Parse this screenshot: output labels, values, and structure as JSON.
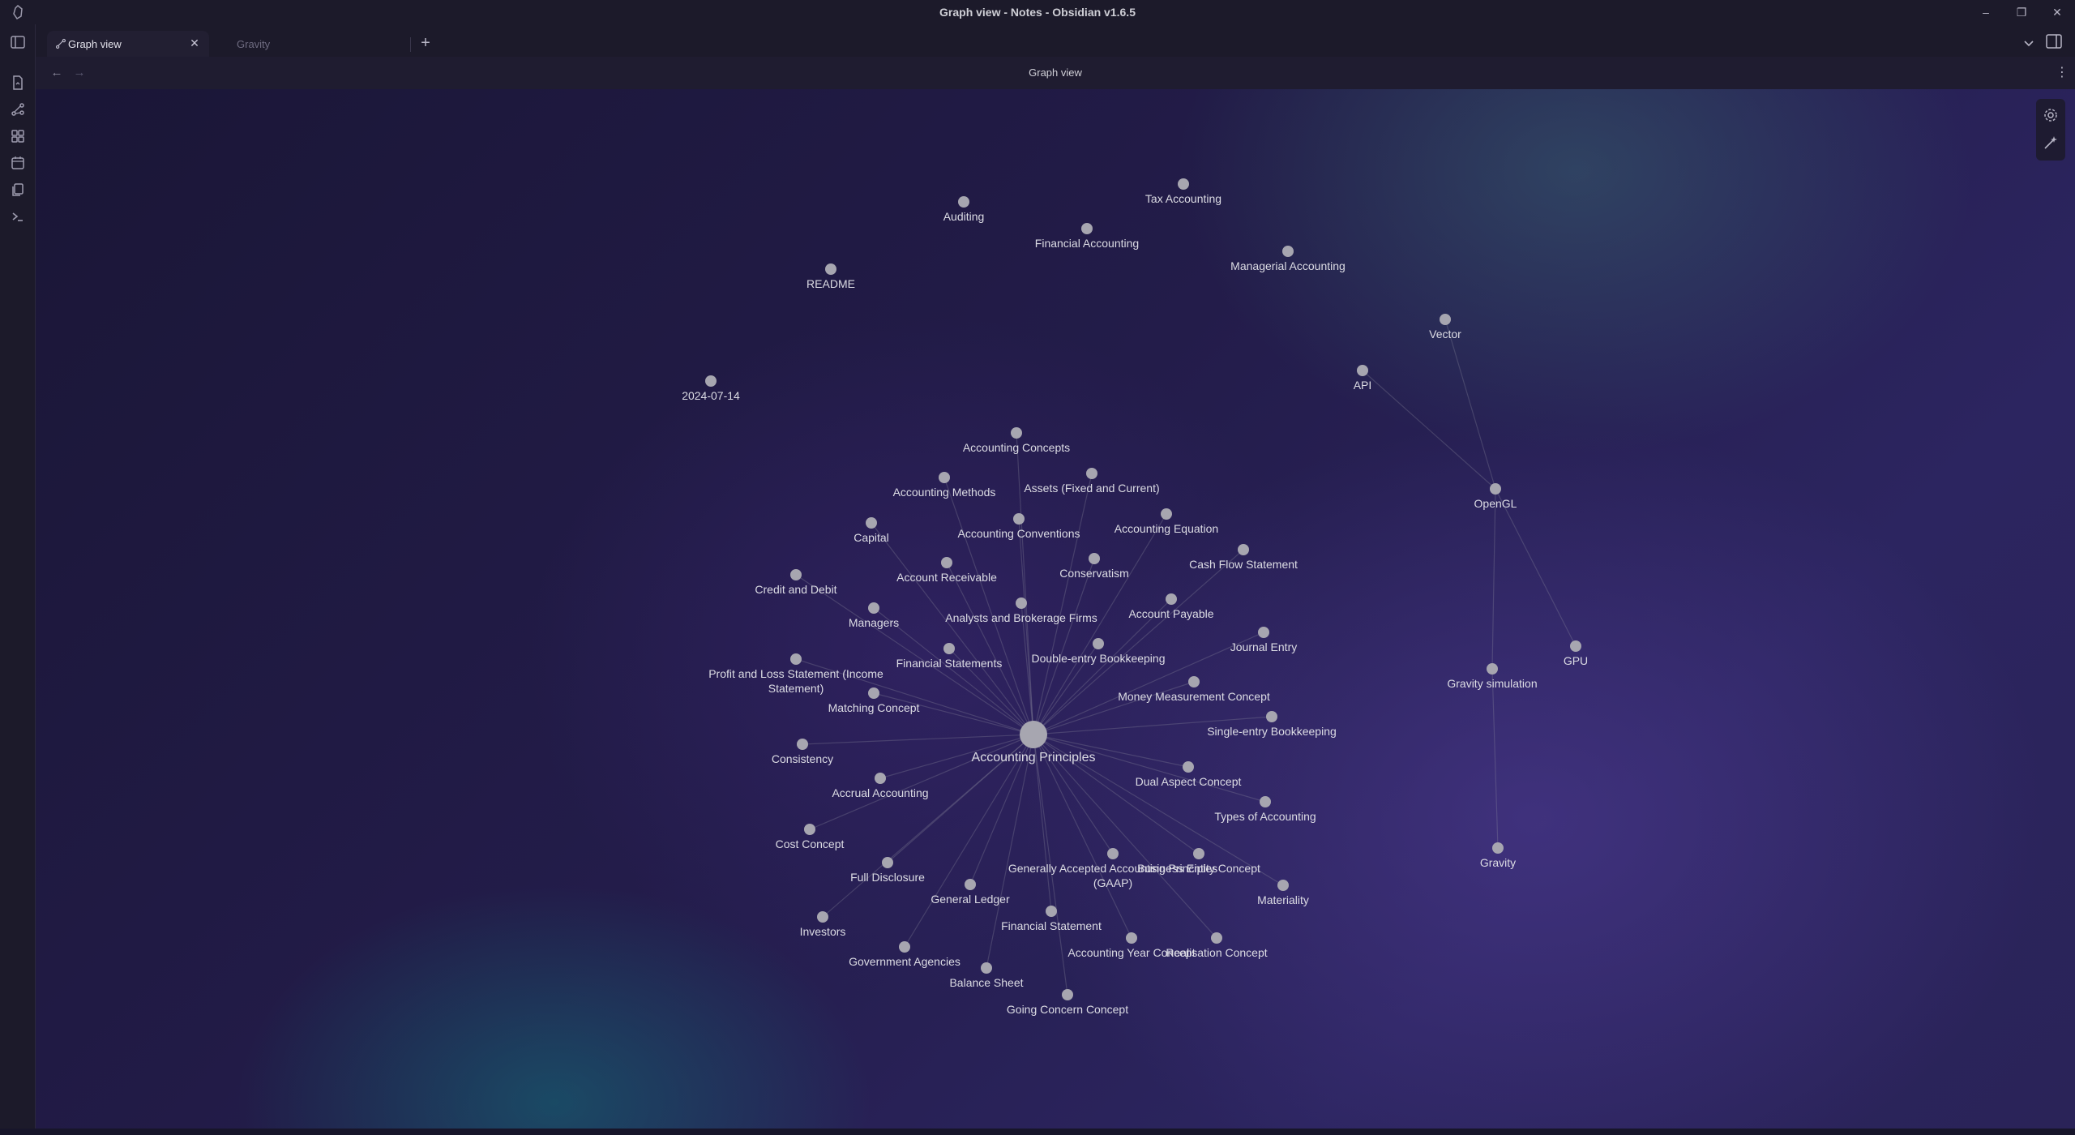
{
  "window": {
    "title": "Graph view - Notes - Obsidian v1.6.5"
  },
  "tabs": [
    {
      "label": "Graph view",
      "active": true
    },
    {
      "label": "Gravity",
      "active": false
    }
  ],
  "view_header": {
    "title": "Graph view"
  },
  "ribbon": [
    {
      "icon": "file-icon"
    },
    {
      "icon": "graph-icon"
    },
    {
      "icon": "canvas-icon"
    },
    {
      "icon": "calendar-icon"
    },
    {
      "icon": "copy-icon"
    },
    {
      "icon": "terminal-icon"
    }
  ],
  "graph": {
    "center": "Accounting Principles",
    "nodes": [
      "Auditing",
      "Tax Accounting",
      "Financial Accounting",
      "Managerial Accounting",
      "README",
      "Vector",
      "API",
      "2024-07-14",
      "OpenGL",
      "GPU",
      "Gravity simulation",
      "Gravity",
      "Accounting Concepts",
      "Assets (Fixed and Current)",
      "Accounting Methods",
      "Accounting Conventions",
      "Capital",
      "Accounting Equation",
      "Cash Flow Statement",
      "Conservatism",
      "Account Receivable",
      "Credit and Debit",
      "Managers",
      "Analysts and Brokerage Firms",
      "Account Payable",
      "Journal Entry",
      "Financial Statements",
      "Double-entry Bookkeeping",
      "Profit and Loss Statement (Income Statement)",
      "Money Measurement Concept",
      "Matching Concept",
      "Single-entry Bookkeeping",
      "Consistency",
      "Dual Aspect Concept",
      "Accrual Accounting",
      "Types of Accounting",
      "Cost Concept",
      "Generally Accepted Accounting Principles (GAAP)",
      "Business Entity Concept",
      "Full Disclosure",
      "General Ledger",
      "Materiality",
      "Investors",
      "Financial Statement",
      "Accounting Year Concept",
      "Realisation Concept",
      "Government Agencies",
      "Balance Sheet",
      "Going Concern Concept"
    ]
  }
}
